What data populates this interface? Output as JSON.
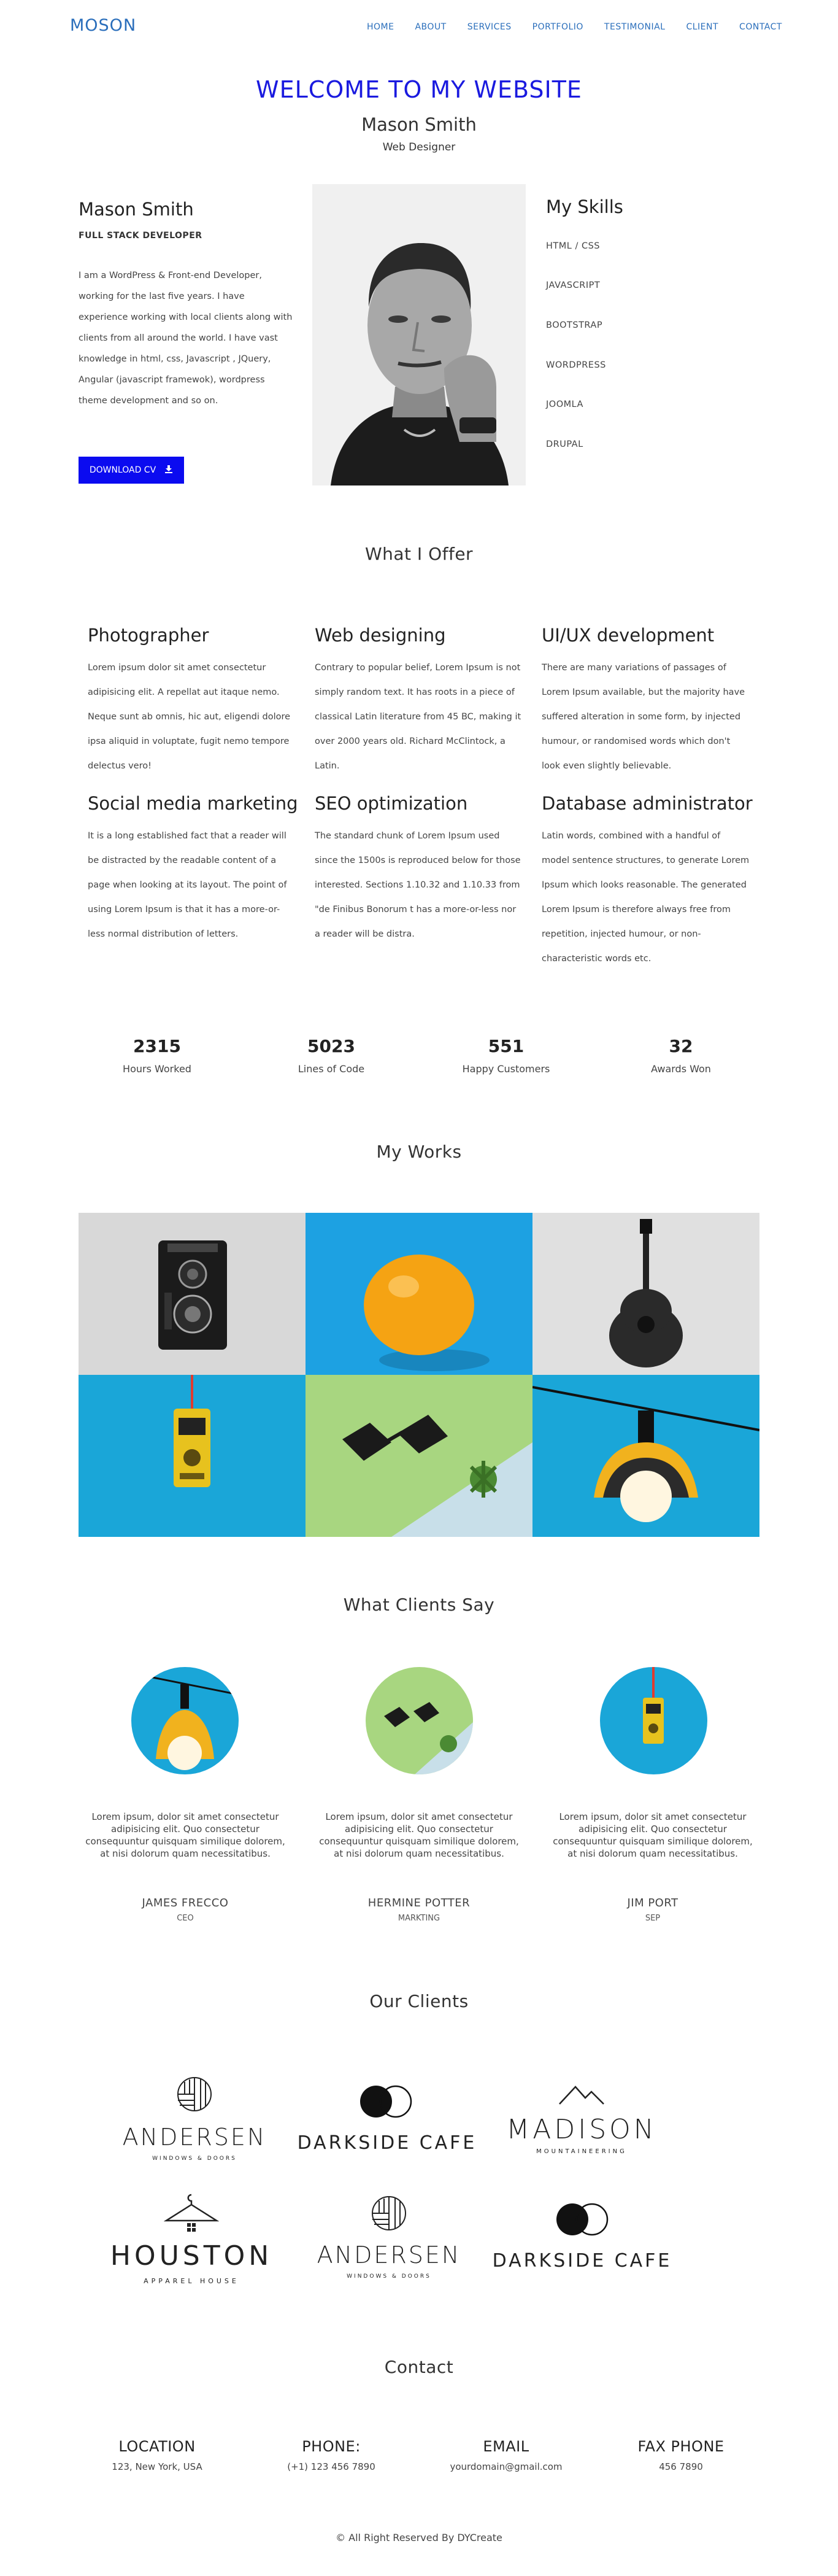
{
  "nav": {
    "logo": "MOSON",
    "items": [
      "HOME",
      "ABOUT",
      "SERVICES",
      "PORTFOLIO",
      "TESTIMONIAL",
      "CLIENT",
      "CONTACT"
    ]
  },
  "hero": {
    "welcome": "WELCOME TO MY WEBSITE",
    "name": "Mason Smith",
    "role": "Web Designer"
  },
  "about": {
    "name": "Mason Smith",
    "subtitle": "FULL STACK DEVELOPER",
    "bio": "I am a WordPress & Front-end Developer, working for the last five years. I have experience working with local clients along with clients from all around the world. I have vast knowledge in html, css, Javascript , JQuery, Angular (javascript framewok), wordpress theme development and so on.",
    "cv_button": "DOWNLOAD CV"
  },
  "skills": {
    "title": "My Skills",
    "items": [
      "HTML / CSS",
      "JAVASCRIPT",
      "BOOTSTRAP",
      "WORDPRESS",
      "JOOMLA",
      "DRUPAL"
    ]
  },
  "services": {
    "title": "What I Offer",
    "items": [
      {
        "title": "Photographer",
        "text": "Lorem ipsum dolor sit amet consectetur adipisicing elit. A repellat aut itaque nemo. Neque sunt ab omnis, hic aut, eligendi dolore ipsa aliquid in voluptate, fugit nemo tempore delectus vero!"
      },
      {
        "title": "Web designing",
        "text": "Contrary to popular belief, Lorem Ipsum is not simply random text. It has roots in a piece of classical Latin literature from 45 BC, making it over 2000 years old. Richard McClintock, a Latin."
      },
      {
        "title": "UI/UX development",
        "text": "There are many variations of passages of Lorem Ipsum available, but the majority have suffered alteration in some form, by injected humour, or randomised words which don't look even slightly believable."
      },
      {
        "title": "Social media marketing",
        "text": "It is a long established fact that a reader will be distracted by the readable content of a page when looking at its layout. The point of using Lorem Ipsum is that it has a more-or-less normal distribution of letters."
      },
      {
        "title": "SEO optimization",
        "text": "The standard chunk of Lorem Ipsum used since the 1500s is reproduced below for those interested. Sections 1.10.32 and 1.10.33 from \"de Finibus Bonorum t has a more-or-less nor a reader will be distra."
      },
      {
        "title": "Database administrator",
        "text": "Latin words, combined with a handful of model sentence structures, to generate Lorem Ipsum which looks reasonable. The generated Lorem Ipsum is therefore always free from repetition, injected humour, or non-characteristic words etc."
      }
    ]
  },
  "counters": [
    {
      "value": "2315",
      "label": "Hours Worked"
    },
    {
      "value": "5023",
      "label": "Lines of Code"
    },
    {
      "value": "551",
      "label": "Happy Customers"
    },
    {
      "value": "32",
      "label": "Awards Won"
    }
  ],
  "works": {
    "title": "My Works"
  },
  "testimonials": {
    "title": "What Clients Say",
    "items": [
      {
        "text": "Lorem ipsum, dolor sit amet consectetur adipisicing elit. Quo consectetur consequuntur quisquam similique dolorem, at nisi dolorum quam necessitatibus.",
        "name": "JAMES FRECCO",
        "role": "CEO"
      },
      {
        "text": "Lorem ipsum, dolor sit amet consectetur adipisicing elit. Quo consectetur consequuntur quisquam similique dolorem, at nisi dolorum quam necessitatibus.",
        "name": "HERMINE POTTER",
        "role": "MARKTING"
      },
      {
        "text": "Lorem ipsum, dolor sit amet consectetur adipisicing elit. Quo consectetur consequuntur quisquam similique dolorem, at nisi dolorum quam necessitatibus.",
        "name": "JIM PORT",
        "role": "SEP"
      }
    ]
  },
  "clients": {
    "title": "Our Clients",
    "brands": [
      "ANDERSEN",
      "WINDOWS & DOORS",
      "DARKSIDE CAFE",
      "MADISON",
      "MOUNTAINEERING",
      "HOUSTON",
      "APPAREL HOUSE"
    ]
  },
  "contact": {
    "title": "Contact",
    "items": [
      {
        "title": "LOCATION",
        "value": "123, New York, USA"
      },
      {
        "title": "PHONE:",
        "value": "(+1) 123 456 7890"
      },
      {
        "title": "EMAIL",
        "value": "yourdomain@gmail.com"
      },
      {
        "title": "FAX PHONE",
        "value": "456 7890"
      }
    ]
  },
  "footer": {
    "text": "© All Right Reserved By DYCreate"
  },
  "colors": {
    "accent": "#2a6ebb",
    "welcome": "#1a1adf",
    "button": "#0b0bf0",
    "gallery_blue": "#1da1e2",
    "gallery_grey": "#d6d6d6"
  }
}
